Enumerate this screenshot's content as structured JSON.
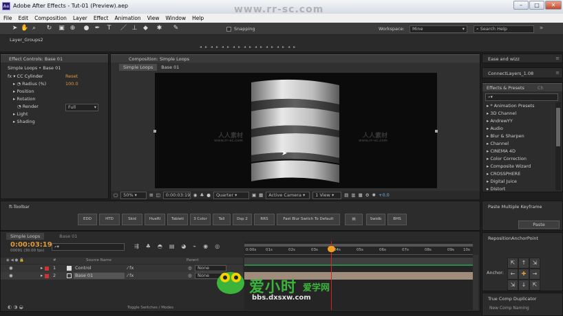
{
  "window": {
    "app_icon": "Ae",
    "title": "Adobe After Effects - Tut-01 (Preview).aep",
    "minimize": "–",
    "maximize": "□",
    "close": "✕"
  },
  "menu": [
    "File",
    "Edit",
    "Composition",
    "Layer",
    "Effect",
    "Animation",
    "View",
    "Window",
    "Help"
  ],
  "toolbar": {
    "snapping_label": "Snapping",
    "workspace_label": "Workspace:",
    "workspace_value": "Mine",
    "search_placeholder": "Search Help"
  },
  "layer_groups_tab": "Layer_Groups2",
  "effect_controls": {
    "tab": "Effect Controls: Base 01",
    "breadcrumb": "Simple Loops • Base 01",
    "fx_name": "CC Cylinder",
    "reset": "Reset",
    "props": [
      {
        "name": "Radius (%)",
        "value": "100.0"
      },
      {
        "name": "Position",
        "value": ""
      },
      {
        "name": "Rotation",
        "value": ""
      },
      {
        "name": "Render",
        "value": "Full"
      },
      {
        "name": "Light",
        "value": ""
      },
      {
        "name": "Shading",
        "value": ""
      }
    ]
  },
  "composition": {
    "tab": "Composition: Simple Loops",
    "crumbs": [
      "Simple Loops",
      "Base 01"
    ],
    "zoom": "50%",
    "timecode": "0:00:03:19",
    "resolution": "Quarter",
    "camera": "Active Camera",
    "views": "1 View",
    "exposure": "+0.0"
  },
  "right_panels": {
    "ease_wizz": "Ease and wizz",
    "connect_layers": "ConnectLayers_1.08",
    "effects_presets_tab": "Effects & Presets",
    "effects_presets_extra": "Ch",
    "search_placeholder": "",
    "categories": [
      "* Animation Presets",
      "3D Channel",
      "AndrewYY",
      "Audio",
      "Blur & Sharpen",
      "Channel",
      "CINEMA 4D",
      "Color Correction",
      "Composite Wizard",
      "CROSSPHERE",
      "Digital Juice",
      "Distort"
    ],
    "paste_kf_tab": "Paste Multiple Keyframe",
    "paste_btn": "Paste",
    "reposition_tab": "RepositionAnchorPoint",
    "anchor_label": "Anchor:",
    "true_comp_tab": "True Comp Duplicator",
    "new_comp_label": "New Comp Naming"
  },
  "ft_toolbar": {
    "tab": "ft-Toolbar",
    "buttons": [
      "EDD",
      "HTD",
      "Skid",
      "HueRl",
      "Tableti",
      "3 Color",
      "Tall",
      "Dsp 2",
      "RRS",
      "Fast Blur Switch To Default",
      "",
      "Swidb",
      "BHS"
    ]
  },
  "timeline": {
    "tabs": [
      "Simple Loops",
      "Base 01"
    ],
    "timecode": "0:00:03:19",
    "frames_info": "00091 (30.00 fps)",
    "search_placeholder": "",
    "col_headers": {
      "num": "#",
      "source": "Source Name",
      "parent": "Parent"
    },
    "layers": [
      {
        "num": "1",
        "name": "Control",
        "parent": "None",
        "color": "#b5b5b5"
      },
      {
        "num": "2",
        "name": "Base 01",
        "parent": "None",
        "color": "#b5b5b5"
      }
    ],
    "ruler": [
      "0:00s",
      "01s",
      "02s",
      "03s",
      "04s",
      "05s",
      "06s",
      "07s",
      "08s",
      "09s",
      "10s"
    ],
    "footer_label": "Toggle Switches / Modes"
  },
  "watermarks": {
    "top_url": "www.rr-sc.com",
    "left_cn": "人人素材",
    "left_url": "www.rr-sc.com",
    "right_cn": "人人素材",
    "right_url": "www.rr-sc.com",
    "bottom_logo_cn": "爱小时",
    "bottom_logo_cn2": "爱学网",
    "bottom_url": "bbs.dxsxw.com"
  },
  "colors": {
    "accent_orange": "#e29a3a",
    "playhead": "#f0a020",
    "cyan": "#6fb7e8",
    "logo_green": "#3cb43c",
    "logo_yellow": "#f3d200"
  }
}
